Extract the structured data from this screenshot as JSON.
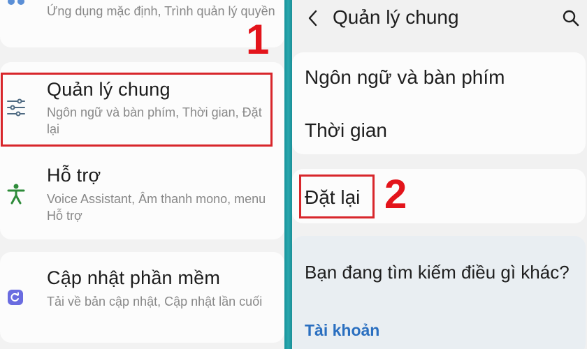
{
  "left": {
    "top_item": {
      "subtitle": "Ứng dụng mặc định, Trình quản lý quyền",
      "icon": "apps-dots-icon"
    },
    "general_management": {
      "title": "Quản lý chung",
      "subtitle": "Ngôn ngữ và bàn phím, Thời gian, Đặt lại",
      "icon": "sliders-icon"
    },
    "accessibility": {
      "title": "Hỗ trợ",
      "subtitle": "Voice Assistant, Âm thanh mono, menu Hỗ trợ",
      "icon": "accessibility-icon"
    },
    "software_update": {
      "title": "Cập nhật phần mềm",
      "subtitle": "Tải về bản cập nhật, Cập nhật lần cuối",
      "icon": "update-icon"
    },
    "step_label": "1"
  },
  "right": {
    "header": {
      "title": "Quản lý chung",
      "back_icon": "back-arrow-icon",
      "search_icon": "search-icon"
    },
    "items": {
      "language": "Ngôn ngữ và bàn phím",
      "time": "Thời gian",
      "reset": "Đặt lại"
    },
    "step_label": "2",
    "suggestion": {
      "question": "Bạn đang tìm kiếm điều gì khác?",
      "link": "Tài khoản"
    }
  },
  "colors": {
    "highlight": "#d8262b",
    "step_number": "#e3141b",
    "divider": "#1e9aa2",
    "accessibility_icon": "#2e8b3a",
    "update_icon": "#6a6ce0",
    "apps_icon": "#5b8fd6",
    "link": "#2a6fc0"
  }
}
